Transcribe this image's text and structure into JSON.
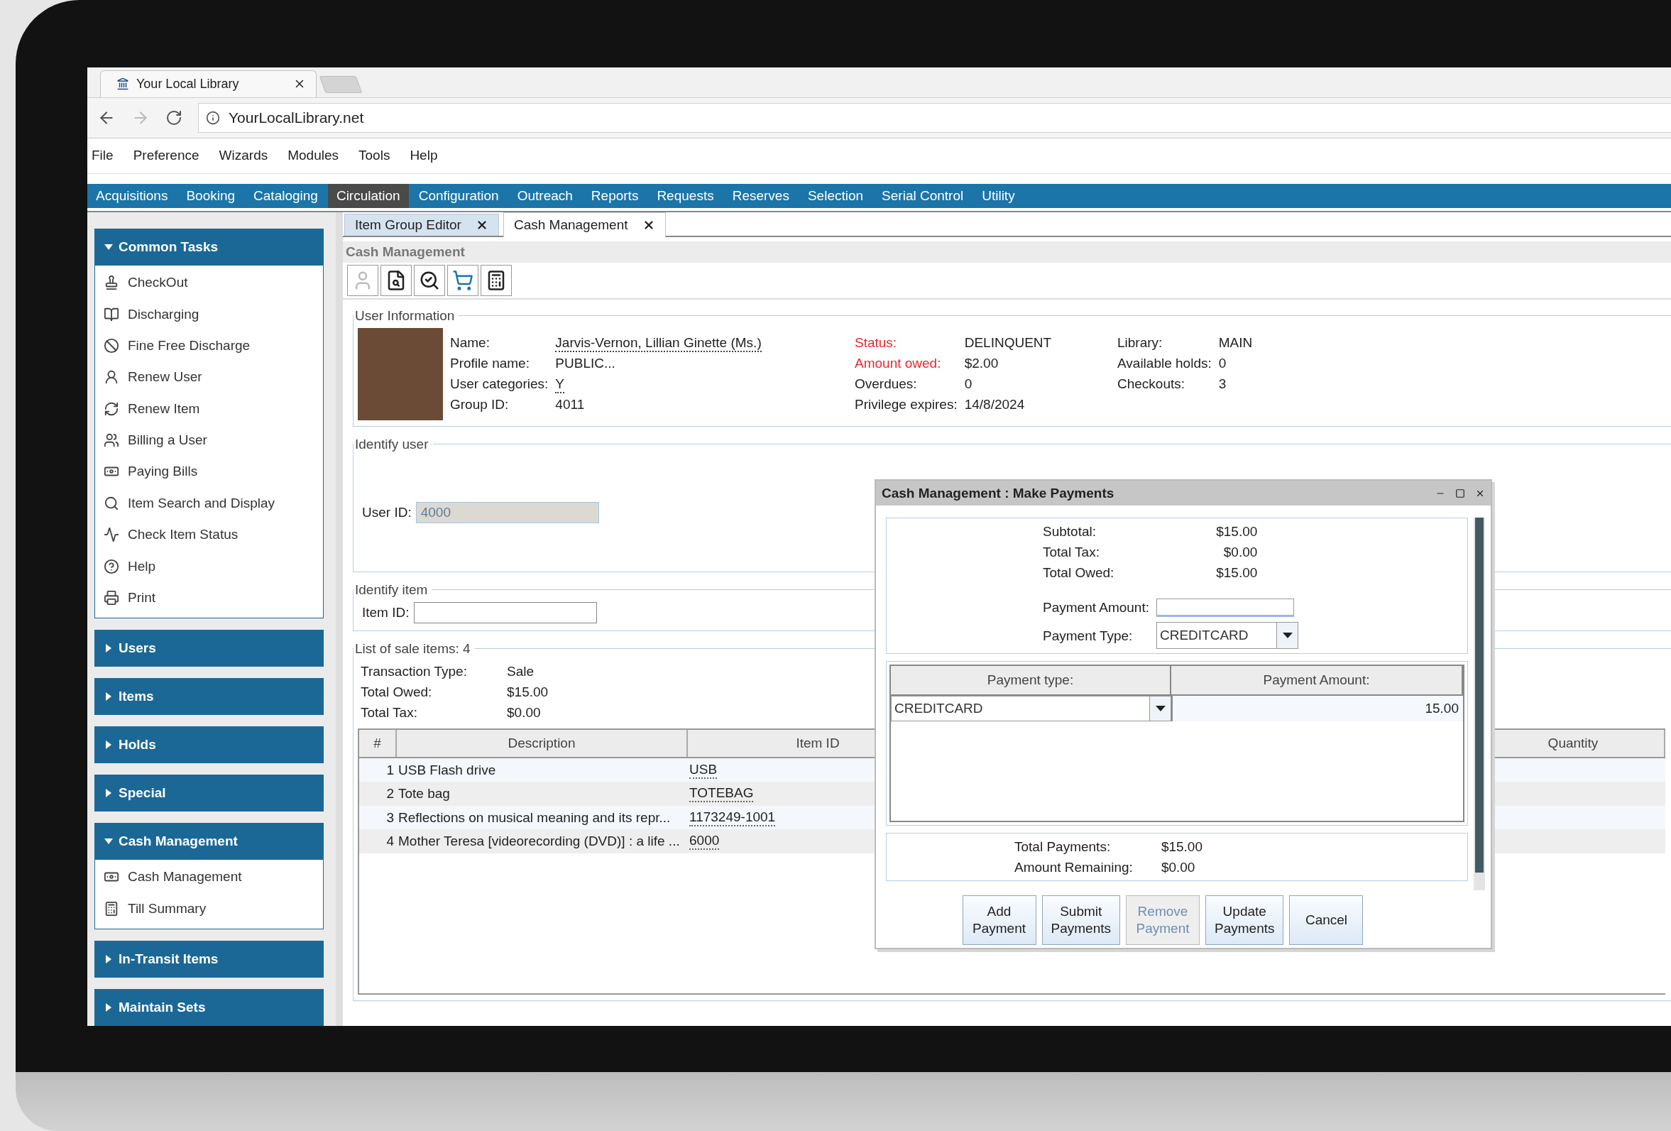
{
  "browser": {
    "tab_title": "Your Local Library",
    "url": "YourLocalLibrary.net"
  },
  "menu": [
    "File",
    "Preference",
    "Wizards",
    "Modules",
    "Tools",
    "Help"
  ],
  "modules": [
    {
      "label": "Acquisitions",
      "selected": false
    },
    {
      "label": "Booking",
      "selected": false
    },
    {
      "label": "Cataloging",
      "selected": false
    },
    {
      "label": "Circulation",
      "selected": true
    },
    {
      "label": "Configuration",
      "selected": false
    },
    {
      "label": "Outreach",
      "selected": false
    },
    {
      "label": "Reports",
      "selected": false
    },
    {
      "label": "Requests",
      "selected": false
    },
    {
      "label": "Reserves",
      "selected": false
    },
    {
      "label": "Selection",
      "selected": false
    },
    {
      "label": "Serial Control",
      "selected": false
    },
    {
      "label": "Utility",
      "selected": false
    }
  ],
  "sidebar": {
    "groups": [
      {
        "title": "Common Tasks",
        "expanded": true,
        "items": [
          "CheckOut",
          "Discharging",
          "Fine Free Discharge",
          "Renew User",
          "Renew Item",
          "Billing a User",
          "Paying Bills",
          "Item Search and Display",
          "Check Item Status",
          "Help",
          "Print"
        ]
      },
      {
        "title": "Users",
        "expanded": false
      },
      {
        "title": "Items",
        "expanded": false
      },
      {
        "title": "Holds",
        "expanded": false
      },
      {
        "title": "Special",
        "expanded": false
      },
      {
        "title": "Cash Management",
        "expanded": true,
        "items": [
          "Cash Management",
          "Till Summary"
        ]
      },
      {
        "title": "In-Transit Items",
        "expanded": false
      },
      {
        "title": "Maintain Sets",
        "expanded": false
      }
    ]
  },
  "content_tabs": [
    {
      "label": "Item Group Editor",
      "selected": false
    },
    {
      "label": "Cash Management",
      "selected": true
    }
  ],
  "panel_title": "Cash Management",
  "toolbar": [
    {
      "disabled": true
    },
    {
      "disabled": false
    },
    {
      "disabled": false
    },
    {
      "disabled": false
    },
    {
      "disabled": false
    }
  ],
  "user_info": {
    "legend": "User Information",
    "columns": [
      [
        {
          "label": "Name:",
          "value": "Jarvis-Vernon, Lillian Ginette (Ms.)",
          "alert": false,
          "link": true
        },
        {
          "label": "Profile name:",
          "value": "PUBLIC...",
          "alert": false,
          "link": false
        },
        {
          "label": "User categories:",
          "value": "Y",
          "alert": false,
          "link": true
        },
        {
          "label": "Group ID:",
          "value": "4011",
          "alert": false,
          "link": false
        }
      ],
      [
        {
          "label": "Status:",
          "value": "DELINQUENT",
          "alert": true,
          "link": false
        },
        {
          "label": "Amount owed:",
          "value": "$2.00",
          "alert": true,
          "link": false
        },
        {
          "label": "Overdues:",
          "value": "0",
          "alert": false,
          "link": false
        },
        {
          "label": "Privilege expires:",
          "value": "14/8/2024",
          "alert": false,
          "link": false
        }
      ],
      [
        {
          "label": "Library:",
          "value": "MAIN",
          "alert": false,
          "link": false
        },
        {
          "label": "Available holds:",
          "value": "0",
          "alert": false,
          "link": false
        },
        {
          "label": "Checkouts:",
          "value": "3",
          "alert": false,
          "link": false
        }
      ]
    ]
  },
  "identify_user": {
    "legend": "Identify user",
    "label": "User ID:",
    "value": "4000",
    "disabled": true
  },
  "identify_item": {
    "legend": "Identify item",
    "label": "Item ID:"
  },
  "sale_items": {
    "legend": "List of sale items: 4",
    "summary": [
      {
        "label": "Transaction Type:",
        "value": "Sale"
      },
      {
        "label": "Total Owed:",
        "value": "$15.00"
      },
      {
        "label": "Total Tax:",
        "value": "$0.00"
      }
    ],
    "columns": [
      "#",
      "Description",
      "Item ID",
      "Quantity"
    ],
    "rows": [
      {
        "number": "1",
        "description": "USB Flash drive",
        "item_id": "USB"
      },
      {
        "number": "2",
        "description": "Tote bag",
        "item_id": "TOTEBAG"
      },
      {
        "number": "3",
        "description": "Reflections on musical meaning and its repr...",
        "item_id": "1173249-1001"
      },
      {
        "number": "4",
        "description": "Mother Teresa [videorecording (DVD)] : a life ...",
        "item_id": "6000"
      }
    ]
  },
  "dialog": {
    "title": "Cash Management : Make Payments",
    "summary": [
      {
        "label": "Subtotal:",
        "value": "$15.00"
      },
      {
        "label": "Total Tax:",
        "value": "$0.00"
      },
      {
        "label": "Total Owed:",
        "value": "$15.00"
      }
    ],
    "payment_amount_label": "Payment Amount:",
    "payment_type_label": "Payment Type:",
    "payment_type_value": "CREDITCARD",
    "grid_columns": [
      "Payment type:",
      "Payment Amount:"
    ],
    "grid_rows": [
      {
        "type": "CREDITCARD",
        "amount": "15.00"
      }
    ],
    "totals": [
      {
        "label": "Total Payments:",
        "value": "$15.00"
      },
      {
        "label": "Amount Remaining:",
        "value": "$0.00"
      }
    ],
    "buttons": [
      {
        "label": "Add Payment",
        "disabled": false
      },
      {
        "label": "Submit Payments",
        "disabled": false
      },
      {
        "label": "Remove Payment",
        "disabled": true
      },
      {
        "label": "Update Payments",
        "disabled": false
      },
      {
        "label": "Cancel",
        "disabled": false
      }
    ]
  }
}
